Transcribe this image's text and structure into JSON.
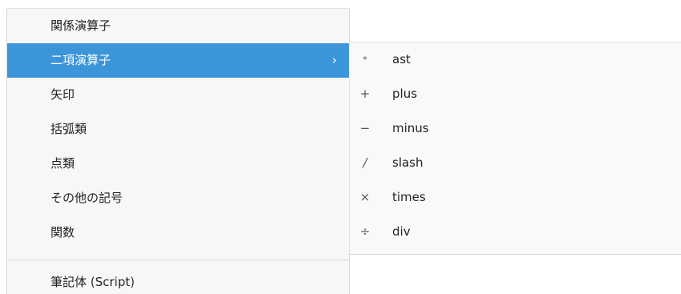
{
  "menu": {
    "items": [
      {
        "label": "関係演算子",
        "active": false
      },
      {
        "label": "二項演算子",
        "active": true,
        "has_submenu": true
      },
      {
        "label": "矢印",
        "active": false
      },
      {
        "label": "括弧類",
        "active": false
      },
      {
        "label": "点類",
        "active": false
      },
      {
        "label": "その他の記号",
        "active": false
      },
      {
        "label": "関数",
        "active": false
      },
      {
        "label": "筆記体 (Script)",
        "active": false
      }
    ],
    "submenu_arrow": "›"
  },
  "submenu": {
    "items": [
      {
        "symbol": "*",
        "label": "ast"
      },
      {
        "symbol": "+",
        "label": "plus"
      },
      {
        "symbol": "−",
        "label": "minus"
      },
      {
        "symbol": "/",
        "label": "slash"
      },
      {
        "symbol": "×",
        "label": "times"
      },
      {
        "symbol": "÷",
        "label": "div"
      }
    ]
  },
  "colors": {
    "active_background": "#3c95d9",
    "active_text": "#ffffff",
    "menu_background": "#f7f7f7",
    "submenu_background": "#f9f9f9"
  }
}
